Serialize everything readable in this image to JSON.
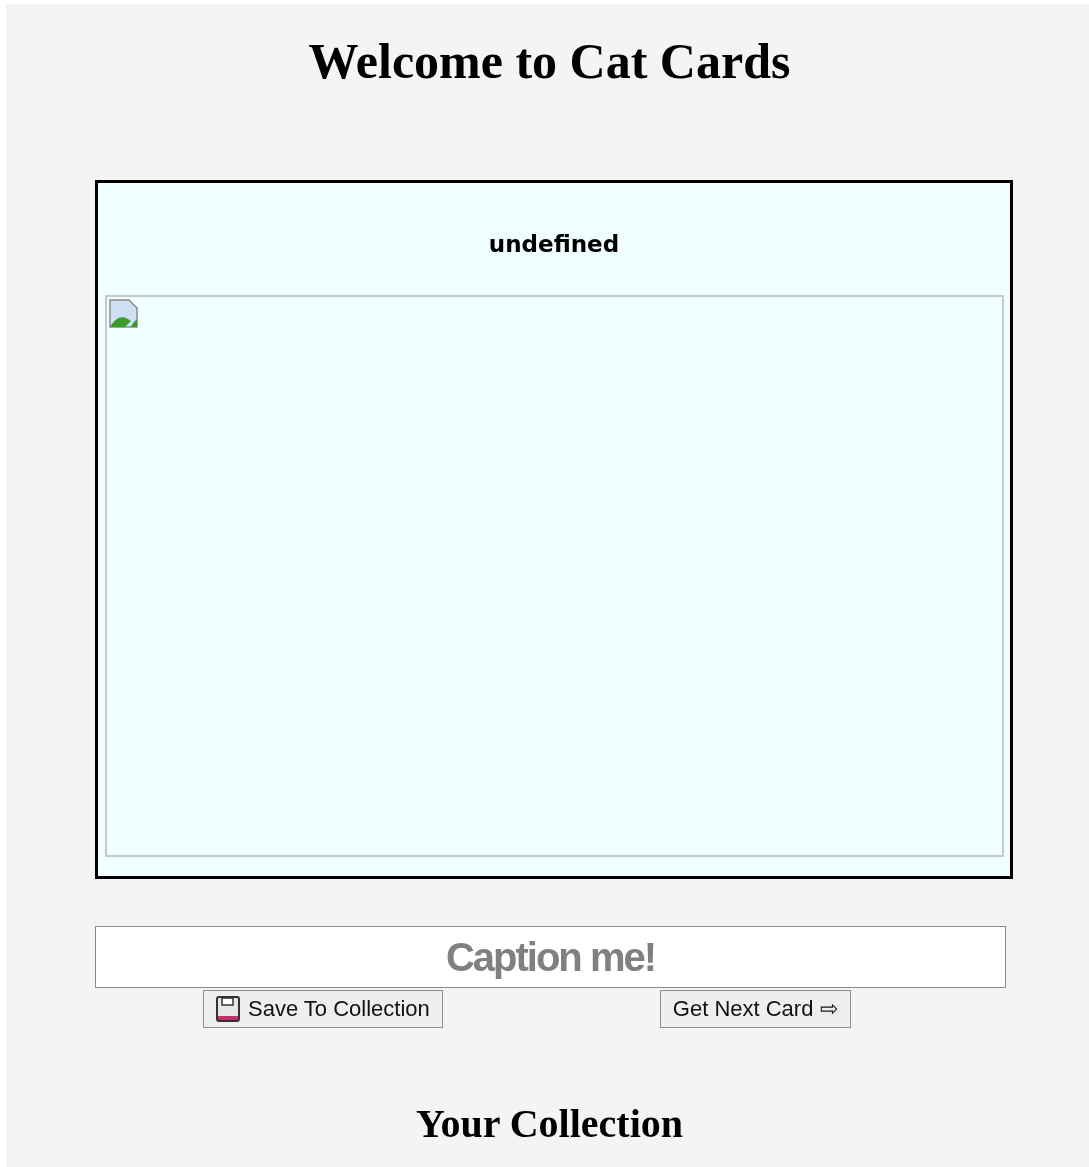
{
  "title": "Welcome to Cat Cards",
  "card": {
    "heading": "undefined",
    "image": {
      "kind": "broken-image"
    }
  },
  "caption": {
    "placeholder": "Caption me!"
  },
  "buttons": [
    {
      "label": "Save To Collection",
      "kind": "save"
    },
    {
      "label": "Get Next Card ⇨",
      "kind": "next"
    }
  ],
  "collection_heading": "Your Collection"
}
